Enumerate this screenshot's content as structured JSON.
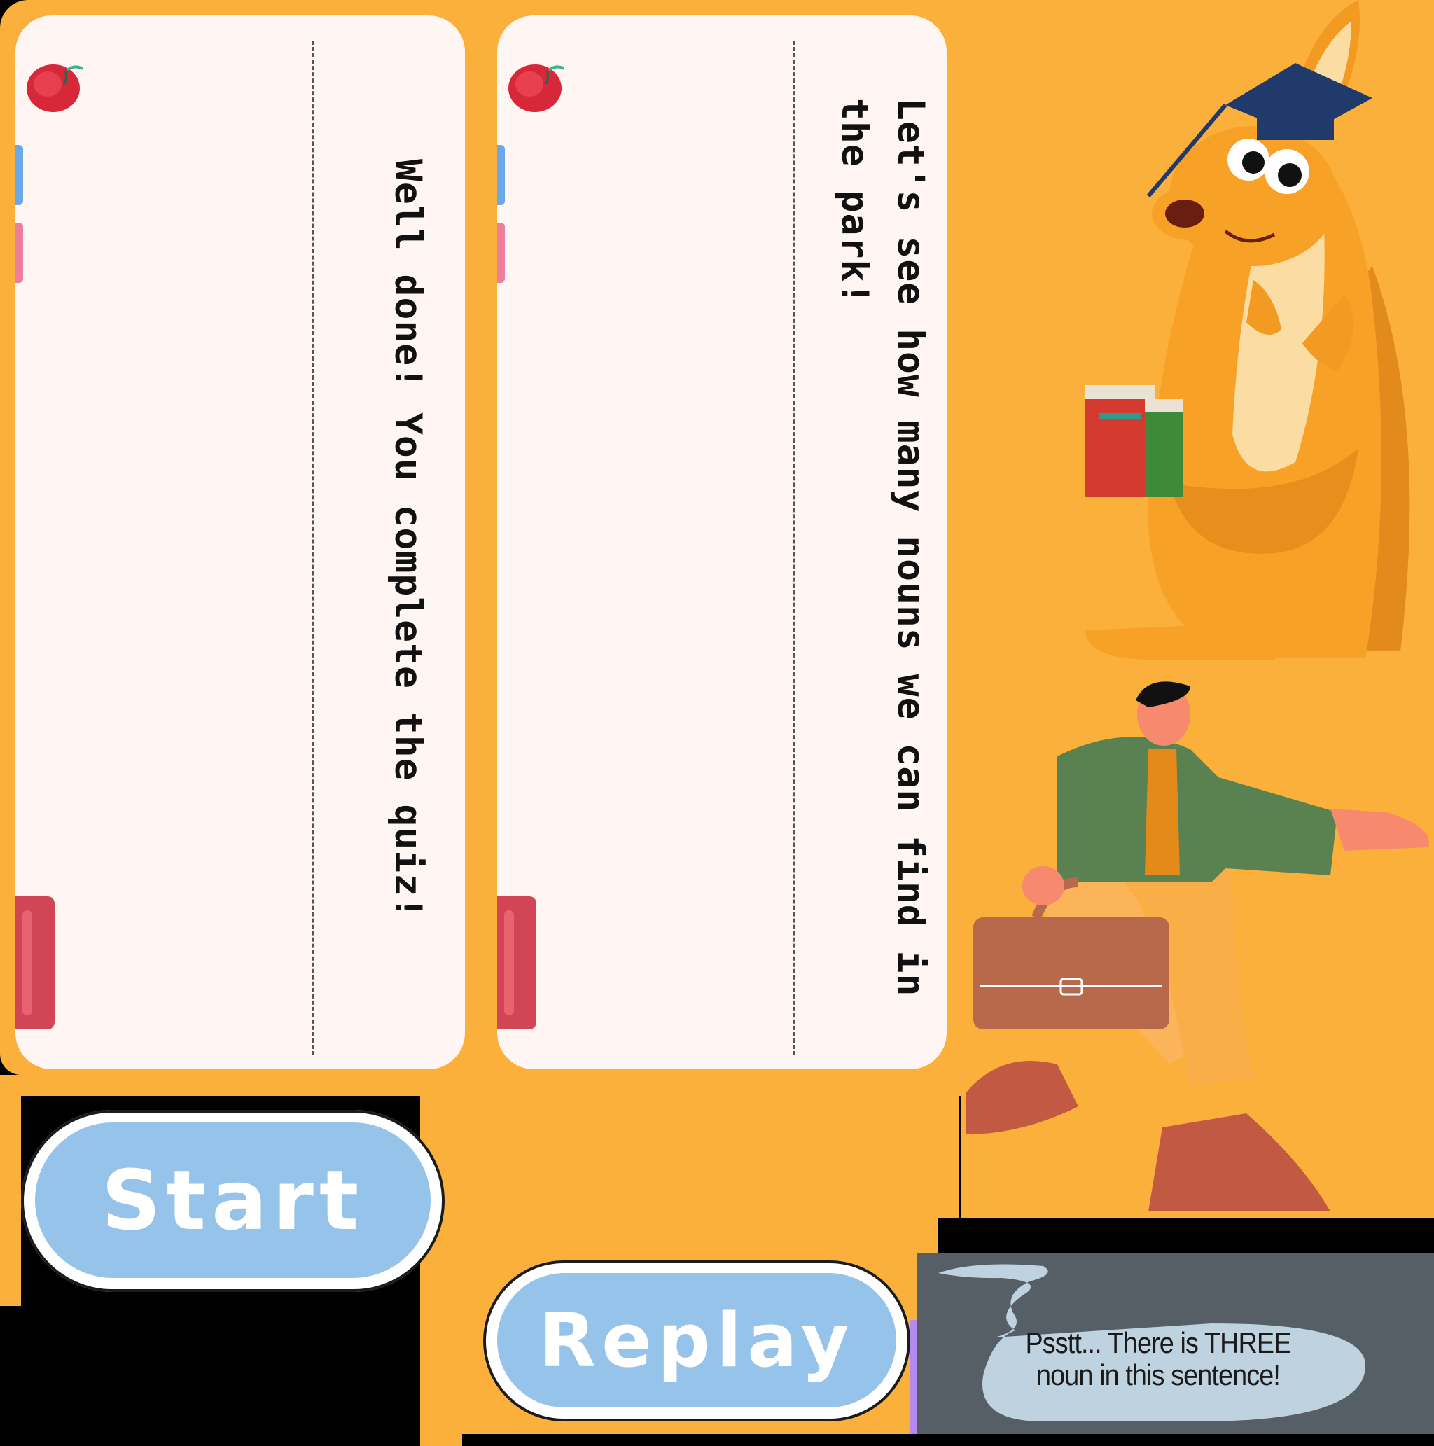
{
  "colors": {
    "background": "#FBB03B",
    "card": "#FFF6F4",
    "button_fill": "#95C3E9",
    "hint_bubble": "#BFD2E0"
  },
  "cards": [
    {
      "text": "Well done! You complete the quiz!",
      "icons": [
        "apple-icon",
        "book-spine-icon"
      ]
    },
    {
      "text": "Let's see how many nouns we can find in the park!",
      "icons": [
        "apple-icon",
        "book-spine-icon"
      ]
    }
  ],
  "buttons": {
    "start": "Start",
    "replay": "Replay"
  },
  "hint": {
    "line1": "Psstt... There is THREE",
    "line2": "noun in this sentence!"
  },
  "characters": [
    "kangaroo-mascot",
    "teacher-with-briefcase"
  ]
}
